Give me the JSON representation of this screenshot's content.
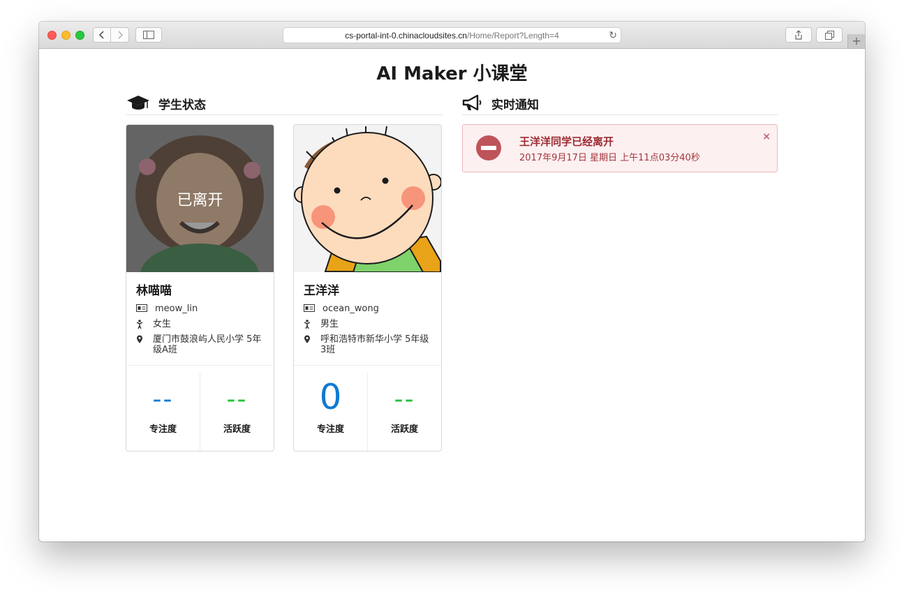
{
  "browser": {
    "url_host": "cs-portal-int-0.chinacloudsites.cn",
    "url_path": "/Home/Report?Length=4",
    "new_tab": "+"
  },
  "page": {
    "title": "AI Maker 小课堂"
  },
  "student_section": {
    "heading": "学生状态",
    "icon": "graduation-cap-icon"
  },
  "notice_section": {
    "heading": "实时通知",
    "icon": "megaphone-icon"
  },
  "students": [
    {
      "name": "林喵喵",
      "username": "meow_lin",
      "gender": "女生",
      "school": "厦门市鼓浪屿人民小学 5年级A班",
      "status_overlay": "已离开",
      "focus_value": "--",
      "focus_label": "专注度",
      "activity_value": "--",
      "activity_label": "活跃度"
    },
    {
      "name": "王洋洋",
      "username": "ocean_wong",
      "gender": "男生",
      "school": "呼和浩特市新华小学 5年级3班",
      "focus_value": "0",
      "focus_label": "专注度",
      "activity_value": "--",
      "activity_label": "活跃度"
    }
  ],
  "notifications": [
    {
      "title": "王洋洋同学已经离开",
      "time": "2017年9月17日 星期日 上午11点03分40秒",
      "close": "×",
      "icon": "no-entry-icon"
    }
  ],
  "colors": {
    "focus": "#0f7ad1",
    "activity": "#22c23a",
    "alert_bg": "#fdf0f1",
    "alert_text": "#9b2a30"
  }
}
